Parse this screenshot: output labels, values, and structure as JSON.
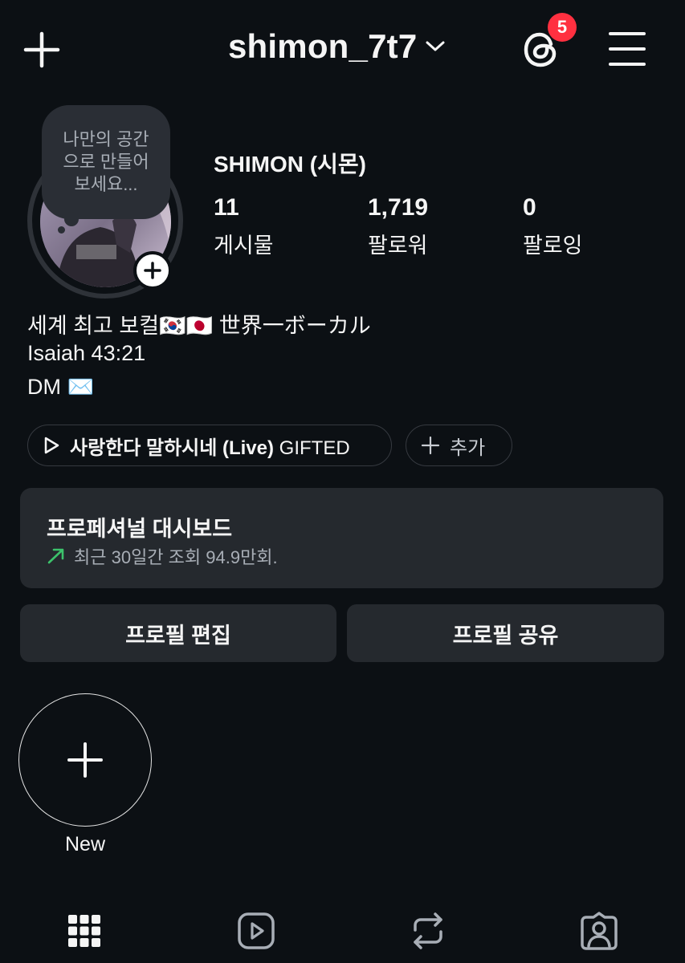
{
  "header": {
    "username": "shimon_7t7",
    "threads_badge_count": "5"
  },
  "profile": {
    "note_text": "나만의 공간으로 만들어보세요...",
    "display_name": "SHIMON (시몬)",
    "stats": [
      {
        "value": "11",
        "label": "게시물"
      },
      {
        "value": "1,719",
        "label": "팔로워"
      },
      {
        "value": "0",
        "label": "팔로잉"
      }
    ],
    "bio": [
      "세계 최고 보컬🇰🇷🇯🇵 世界一ボーカル",
      "Isaiah 43:21",
      "DM ✉️"
    ]
  },
  "chips": {
    "music_title": "사랑한다 말하시네 (Live)",
    "music_artist": "GIFTED",
    "add_label": "추가"
  },
  "dashboard": {
    "title": "프로페셔널 대시보드",
    "subtitle": "최근 30일간 조회 94.9만회.",
    "trend_color": "#3cc26b"
  },
  "buttons": {
    "edit_profile": "프로필 편집",
    "share_profile": "프로필 공유"
  },
  "highlights": {
    "new_label": "New"
  },
  "tabs": [
    "grid-icon",
    "reels-icon",
    "reposts-icon",
    "tagged-icon"
  ],
  "colors": {
    "background": "#0c1014",
    "surface": "#25292e",
    "badge": "#ff3040"
  }
}
